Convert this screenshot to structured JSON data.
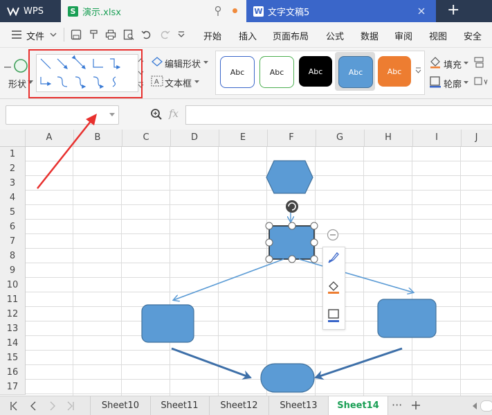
{
  "titlebar": {
    "wps_label": "WPS",
    "file_tab": "演示.xlsx",
    "doc_tab": "文字文稿5",
    "new_tab": "+"
  },
  "menu": {
    "file": "文件",
    "items": [
      "开始",
      "插入",
      "页面布局",
      "公式",
      "数据",
      "审阅",
      "视图",
      "安全"
    ]
  },
  "ribbon": {
    "shape_label": "形状",
    "edit_shape": "编辑形状",
    "text_box": "文本框",
    "style_label": "Abc",
    "fill": "填充",
    "outline": "轮廓"
  },
  "formula": {
    "fx": "fx"
  },
  "columns": [
    "A",
    "B",
    "C",
    "D",
    "E",
    "F",
    "G",
    "H",
    "I",
    "J"
  ],
  "rows": [
    "1",
    "2",
    "3",
    "4",
    "5",
    "6",
    "7",
    "8",
    "9",
    "10",
    "11",
    "12",
    "13",
    "14",
    "15",
    "16",
    "17"
  ],
  "sheets": [
    "Sheet10",
    "Sheet11",
    "Sheet12",
    "Sheet13",
    "Sheet14"
  ],
  "active_sheet": "Sheet14",
  "colors": {
    "shape_fill": "#5b9bd5",
    "shape_stroke": "#41719c",
    "annotation_red": "#e8302e",
    "active_green": "#1a9f55"
  }
}
